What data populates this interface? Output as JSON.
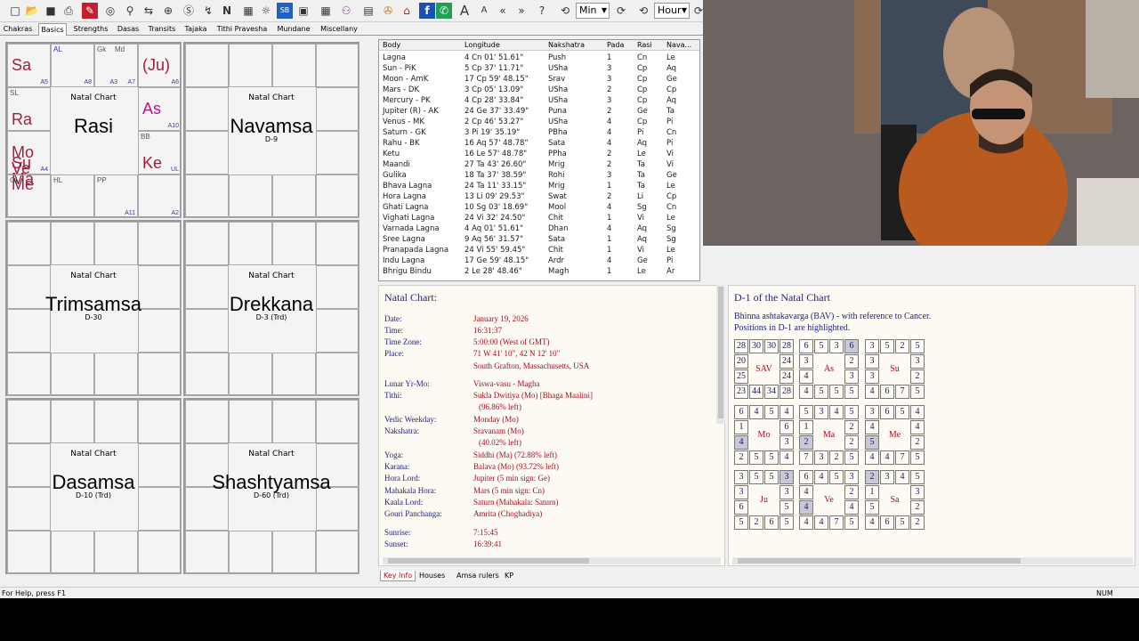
{
  "toolbar": {
    "time_unit_1": "Min",
    "time_unit_2": "Hour"
  },
  "tabs": [
    "Chakras",
    "Basics",
    "Strengths",
    "Dasas",
    "Transits",
    "Tajaka",
    "Tithi Pravesha",
    "Mundane",
    "Miscellany"
  ],
  "charts": [
    {
      "name": "Rasi",
      "subtitle": "",
      "natal": "Natal Chart",
      "cells": {
        "0": [
          {
            "t": "Sa",
            "c": "red",
            "s": "big"
          },
          {
            "t": "A5",
            "c": "tiny"
          }
        ],
        "1": [
          {
            "t": "AL",
            "c": "blu",
            "s": "sm2"
          },
          {
            "t": "A8",
            "c": "tiny"
          }
        ],
        "2": [
          {
            "t": "Gk",
            "c": "sm"
          },
          {
            "t": "Md",
            "c": "sm"
          },
          {
            "t": "A7",
            "c": "tiny"
          },
          {
            "t": "A3",
            "c": "tiny"
          }
        ],
        "3": [
          {
            "t": "(Ju)",
            "c": "red",
            "s": "big"
          },
          {
            "t": "A6",
            "c": "tiny"
          }
        ],
        "4": [
          {
            "t": "SL",
            "c": "sm"
          },
          {
            "t": "Ra",
            "c": "red",
            "s": "big"
          }
        ],
        "7": [
          {
            "t": "As",
            "c": "mag",
            "s": "big"
          },
          {
            "t": "A10",
            "c": "tiny"
          }
        ],
        "8": [
          {
            "t": "Mo Ve Me",
            "c": "red",
            "s": "big"
          },
          {
            "t": "Su Ma",
            "c": "red",
            "s": "big"
          },
          {
            "t": "A4",
            "c": "tiny"
          }
        ],
        "11": [
          {
            "t": "BB",
            "c": "sm"
          },
          {
            "t": "Ke",
            "c": "red",
            "s": "big"
          },
          {
            "t": "UL",
            "c": "tiny"
          }
        ],
        "12": [
          {
            "t": "GL",
            "c": "sm"
          }
        ],
        "13": [
          {
            "t": "HL",
            "c": "sm"
          }
        ],
        "14": [
          {
            "t": "PP",
            "c": "sm"
          },
          {
            "t": "A11",
            "c": "tiny"
          }
        ],
        "15": [
          {
            "t": "A2",
            "c": "tiny"
          }
        ]
      }
    },
    {
      "name": "Navamsa",
      "subtitle": "D-9",
      "natal": "Natal Chart"
    },
    {
      "name": "Trimsamsa",
      "subtitle": "D-30",
      "natal": "Natal Chart"
    },
    {
      "name": "Drekkana",
      "subtitle": "D-3 (Trd)",
      "natal": "Natal Chart"
    },
    {
      "name": "Dasamsa",
      "subtitle": "D-10 (Trd)",
      "natal": "Natal Chart"
    },
    {
      "name": "Shashtyamsa",
      "subtitle": "D-60 (Trd)",
      "natal": "Natal Chart"
    }
  ],
  "table": {
    "headers": [
      "Body",
      "Longitude",
      "Nakshatra",
      "Pada",
      "Rasi",
      "Nava..."
    ],
    "rows": [
      [
        "Lagna",
        "4 Cn 01' 51.61\"",
        "Push",
        "1",
        "Cn",
        "Le"
      ],
      [
        "Sun - PiK",
        "5 Cp 37' 11.71\"",
        "USha",
        "3",
        "Cp",
        "Aq"
      ],
      [
        "Moon - AmK",
        "17 Cp 59' 48.15\"",
        "Srav",
        "3",
        "Cp",
        "Ge"
      ],
      [
        "Mars - DK",
        "3 Cp 05' 13.09\"",
        "USha",
        "2",
        "Cp",
        "Cp"
      ],
      [
        "Mercury - PK",
        "4 Cp 28' 33.84\"",
        "USha",
        "3",
        "Cp",
        "Aq"
      ],
      [
        "Jupiter (R) - AK",
        "24 Ge 37' 33.49\"",
        "Puna",
        "2",
        "Ge",
        "Ta"
      ],
      [
        "Venus - MK",
        "2 Cp 46' 53.27\"",
        "USha",
        "4",
        "Cp",
        "Pi"
      ],
      [
        "Saturn - GK",
        "3 Pi 19' 35.19\"",
        "PBha",
        "4",
        "Pi",
        "Cn"
      ],
      [
        "Rahu - BK",
        "16 Aq 57' 48.78\"",
        "Sata",
        "4",
        "Aq",
        "Pi"
      ],
      [
        "Ketu",
        "16 Le 57' 48.78\"",
        "PPha",
        "2",
        "Le",
        "Vi"
      ],
      [
        "Maandi",
        "27 Ta 43' 26.60\"",
        "Mrig",
        "2",
        "Ta",
        "Vi"
      ],
      [
        "Gulika",
        "18 Ta 37' 38.59\"",
        "Rohi",
        "3",
        "Ta",
        "Ge"
      ],
      [
        "Bhava Lagna",
        "24 Ta 11' 33.15\"",
        "Mrig",
        "1",
        "Ta",
        "Le"
      ],
      [
        "Hora Lagna",
        "13 Li 09' 29.53\"",
        "Swat",
        "2",
        "Li",
        "Cp"
      ],
      [
        "Ghati Lagna",
        "10 Sg 03' 18.69\"",
        "Mool",
        "4",
        "Sg",
        "Cn"
      ],
      [
        "Vighati Lagna",
        "24 Vi 32' 24.50\"",
        "Chit",
        "1",
        "Vi",
        "Le"
      ],
      [
        "Varnada Lagna",
        "4 Aq 01' 51.61\"",
        "Dhan",
        "4",
        "Aq",
        "Sg"
      ],
      [
        "Sree Lagna",
        "9 Aq 56' 31.57\"",
        "Sata",
        "1",
        "Aq",
        "Sg"
      ],
      [
        "Pranapada Lagna",
        "24 Vi 55' 59.45\"",
        "Chit",
        "1",
        "Vi",
        "Le"
      ],
      [
        "Indu Lagna",
        "17 Ge 59' 48.15\"",
        "Ardr",
        "4",
        "Ge",
        "Pi"
      ],
      [
        "Bhrigu Bindu",
        "2 Le 28' 48.46\"",
        "Magh",
        "1",
        "Le",
        "Ar"
      ]
    ]
  },
  "keyinfo": {
    "title": "Natal Chart:",
    "rows": [
      [
        "Date:",
        "January 19, 2026"
      ],
      [
        "Time:",
        "16:31:37"
      ],
      [
        "Time Zone:",
        "5:00:00 (West of GMT)"
      ],
      [
        "Place:",
        "71 W 41' 10\", 42 N 12' 10\""
      ],
      [
        "",
        "South Grafton, Massachusetts, USA"
      ],
      [
        "Lunar Yr-Mo:",
        "Viswa-vasu - Magha"
      ],
      [
        "Tithi:",
        "Sukla Dwitiya (Mo) [Bhaga Maalini]"
      ],
      [
        "",
        "(96.86% left)"
      ],
      [
        "Vedic Weekday:",
        "Monday (Mo)"
      ],
      [
        "Nakshatra:",
        "Sravanam (Mo)"
      ],
      [
        "",
        "(40.02% left)"
      ],
      [
        "Yoga:",
        "Siddhi (Ma) (72.88% left)"
      ],
      [
        "Karana:",
        "Balava (Mo) (93.72% left)"
      ],
      [
        "Hora Lord:",
        "Jupiter (5 min sign: Ge)"
      ],
      [
        "Mahakala Hora:",
        "Mars (5 min sign: Cn)"
      ],
      [
        "Kaala Lord:",
        "Saturn (Mahakala: Saturn)"
      ],
      [
        "Gouri Panchanga:",
        "Amrita (Choghadiya)"
      ],
      [
        "Sunrise:",
        "7:15:45"
      ],
      [
        "Sunset:",
        "16:39:41"
      ]
    ]
  },
  "bav": {
    "title": "D-1 of the Natal Chart",
    "subtitle1": "Bhinna ashtakavarga (BAV) - with reference to Cancer.",
    "subtitle2": "Positions in D-1 are highlighted.",
    "grids": [
      {
        "label": "SAV",
        "vals": [
          "28",
          "30",
          "30",
          "28",
          "24",
          "24",
          "28",
          "34",
          "44",
          "23",
          "25",
          "20"
        ],
        "hi": []
      },
      {
        "label": "As",
        "vals": [
          "6",
          "5",
          "3",
          "6",
          "2",
          "3",
          "5",
          "5",
          "5",
          "4",
          "4",
          "3"
        ],
        "hi": [
          3
        ]
      },
      {
        "label": "Su",
        "vals": [
          "3",
          "5",
          "2",
          "5",
          "3",
          "2",
          "5",
          "7",
          "6",
          "4",
          "3",
          "3"
        ],
        "hi": []
      },
      {
        "label": "Mo",
        "vals": [
          "6",
          "4",
          "5",
          "4",
          "6",
          "3",
          "4",
          "5",
          "5",
          "2",
          "4",
          "1"
        ],
        "hi": [
          10
        ]
      },
      {
        "label": "Ma",
        "vals": [
          "5",
          "3",
          "4",
          "5",
          "2",
          "2",
          "5",
          "2",
          "3",
          "7",
          "2",
          "1"
        ],
        "hi": [
          10
        ]
      },
      {
        "label": "Me",
        "vals": [
          "3",
          "6",
          "5",
          "4",
          "4",
          "2",
          "5",
          "7",
          "4",
          "4",
          "5",
          "4"
        ],
        "hi": [
          10
        ]
      },
      {
        "label": "Ju",
        "vals": [
          "3",
          "5",
          "5",
          "3",
          "3",
          "5",
          "5",
          "6",
          "2",
          "5",
          "6",
          "3"
        ],
        "hi": [
          3
        ]
      },
      {
        "label": "Ve",
        "vals": [
          "6",
          "4",
          "5",
          "3",
          "2",
          "4",
          "5",
          "7",
          "4",
          "4",
          "4",
          "4"
        ],
        "hi": [
          10
        ]
      },
      {
        "label": "Sa",
        "vals": [
          "2",
          "3",
          "4",
          "5",
          "3",
          "2",
          "2",
          "5",
          "6",
          "4",
          "5",
          "1"
        ],
        "hi": [
          0
        ]
      }
    ]
  },
  "bottom_tabs": [
    "Key Info",
    "Houses",
    "Amsa rulers",
    "KP"
  ],
  "status": {
    "help": "For Help, press F1",
    "num": "NUM"
  }
}
